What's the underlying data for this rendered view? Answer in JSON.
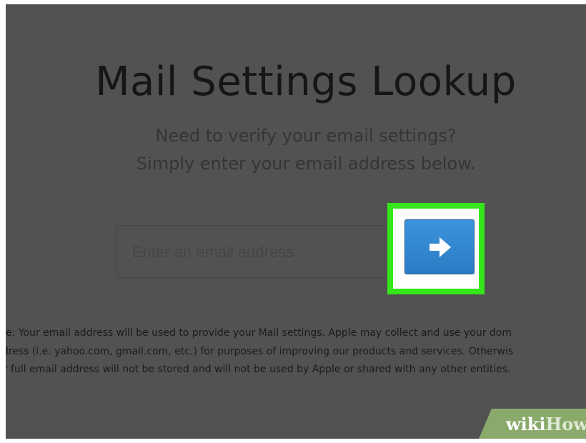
{
  "page": {
    "title": "Mail Settings Lookup",
    "subtitle_line1": "Need to verify your email settings?",
    "subtitle_line2": "Simply enter your email address below."
  },
  "form": {
    "email_placeholder": "Enter an email address",
    "submit_icon": "arrow-right-icon"
  },
  "note": {
    "line1": "ote: Your email address will be used to provide your Mail settings. Apple may collect and use your dom",
    "line2": "ldress (i.e. yahoo.com, gmail.com, etc.) for purposes of improving our products and services. Otherwis",
    "line3": "ur full email address will not be stored and will not be used by Apple or shared with any other entities."
  },
  "watermark": {
    "part1": "wiki",
    "part2": "How"
  },
  "colors": {
    "overlay": "#525252",
    "highlight": "#35e61a",
    "button": "#2f86d0",
    "watermark": "#8aaa6b"
  }
}
